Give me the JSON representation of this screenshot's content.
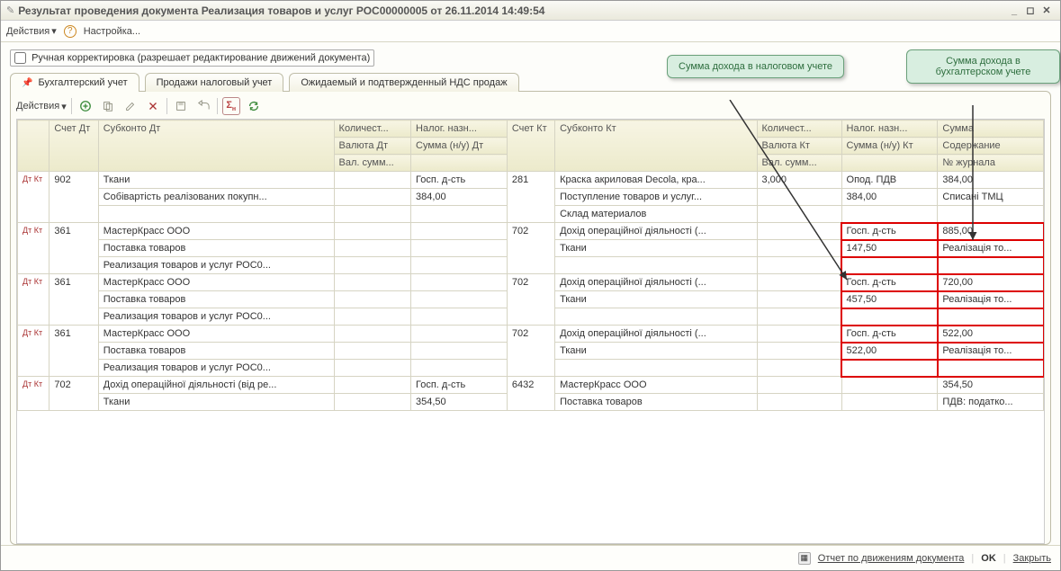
{
  "window": {
    "title": "Результат проведения документа Реализация товаров и услуг РОС00000005 от 26.11.2014 14:49:54"
  },
  "menubar": {
    "actions": "Действия",
    "settings": "Настройка..."
  },
  "manual_edit": "Ручная корректировка (разрешает редактирование движений документа)",
  "tabs": {
    "t1": "Бухгалтерский учет",
    "t2": "Продажи налоговый учет",
    "t3": "Ожидаемый и подтвержденный НДС продаж"
  },
  "inner_actions": "Действия",
  "callouts": {
    "tax": "Сумма дохода в налоговом учете",
    "acc": "Сумма дохода в бухгалтерском учете"
  },
  "headers": {
    "schet_dt": "Счет Дт",
    "subkonto_dt": "Субконто Дт",
    "kolich": "Количест...",
    "nalog_nazn": "Налог. назн...",
    "valuta_dt": "Валюта Дт",
    "summa_nu_dt": "Сумма (н/у) Дт",
    "val_summ": "Вал. сумм...",
    "schet_kt": "Счет Кт",
    "subkonto_kt": "Субконто Кт",
    "valuta_kt": "Валюта Кт",
    "nalog_nazn_kt": "Налог. назн...",
    "summa_nu_kt": "Сумма (н/у) Кт",
    "summa": "Сумма",
    "soderzhanie": "Содержание",
    "nomer_zh": "№ журнала"
  },
  "rows": [
    {
      "icon": "Дт Кт",
      "schet_dt": "902",
      "sub_dt": [
        "Ткани",
        "Собівартість реалізованих покупн..."
      ],
      "kolich": "",
      "nalog_dt": [
        "Госп. д-сть",
        "384,00"
      ],
      "schet_kt": "281",
      "sub_kt": [
        "Краска акриловая Decola, кра...",
        "Поступление товаров и услуг...",
        "Склад материалов"
      ],
      "kolich_kt": "3,000",
      "nalog_kt": [
        "Опод. ПДВ",
        "384,00"
      ],
      "summa": [
        "384,00",
        "Списані ТМЦ"
      ]
    },
    {
      "icon": "Дт Кт",
      "schet_dt": "361",
      "sub_dt": [
        " МастерКрасс ООО",
        "Поставка товаров",
        "Реализация товаров и услуг РОС0..."
      ],
      "nalog_dt": [
        "",
        ""
      ],
      "schet_kt": "702",
      "sub_kt": [
        "Дохід операційної діяльності (...",
        "Ткани"
      ],
      "nalog_kt": [
        "Госп. д-сть",
        "147,50"
      ],
      "summa": [
        "885,00",
        "Реалізація то..."
      ]
    },
    {
      "icon": "Дт Кт",
      "schet_dt": "361",
      "sub_dt": [
        " МастерКрасс ООО",
        "Поставка товаров",
        "Реализация товаров и услуг РОС0..."
      ],
      "nalog_dt": [
        "",
        ""
      ],
      "schet_kt": "702",
      "sub_kt": [
        "Дохід операційної діяльності (...",
        "Ткани"
      ],
      "nalog_kt": [
        "Госп. д-сть",
        "457,50"
      ],
      "summa": [
        "720,00",
        "Реалізація то..."
      ]
    },
    {
      "icon": "Дт Кт",
      "schet_dt": "361",
      "sub_dt": [
        " МастерКрасс ООО",
        "Поставка товаров",
        "Реализация товаров и услуг РОС0..."
      ],
      "nalog_dt": [
        "",
        ""
      ],
      "schet_kt": "702",
      "sub_kt": [
        "Дохід операційної діяльності (...",
        "Ткани"
      ],
      "nalog_kt": [
        "Госп. д-сть",
        "522,00"
      ],
      "summa": [
        "522,00",
        "Реалізація то..."
      ]
    },
    {
      "icon": "Дт Кт",
      "schet_dt": "702",
      "sub_dt": [
        "Дохід операційної діяльності (від ре...",
        "Ткани"
      ],
      "nalog_dt": [
        "Госп. д-сть",
        "354,50"
      ],
      "schet_kt": "6432",
      "sub_kt": [
        " МастерКрасс ООО",
        "Поставка товаров"
      ],
      "nalog_kt": [
        "",
        ""
      ],
      "summa": [
        "354,50",
        "ПДВ: податко..."
      ]
    }
  ],
  "footer": {
    "report": "Отчет по движениям документа",
    "ok": "OK",
    "close": "Закрыть"
  }
}
